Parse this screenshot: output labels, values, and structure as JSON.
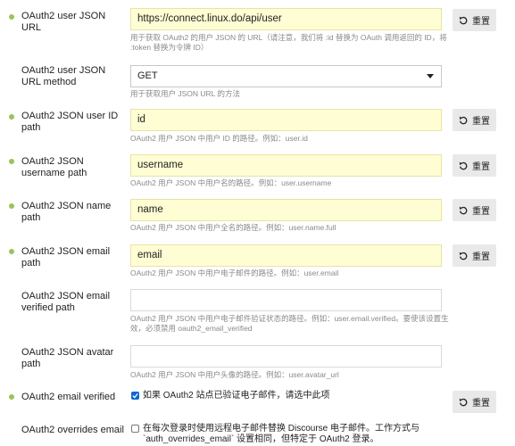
{
  "reset_label": "重置",
  "rows": [
    {
      "label": "OAuth2 user JSON URL",
      "value": "https://connect.linux.do/api/user",
      "desc": "用于获取 OAuth2 的用户 JSON 的 URL（请注意，我们将 :id 替换为 OAuth 调用返回的 ID，将 :token 替换为令牌 ID）"
    },
    {
      "label": "OAuth2 user JSON URL method",
      "value": "GET",
      "desc": "用于获取用户 JSON URL 的方法"
    },
    {
      "label": "OAuth2 JSON user ID path",
      "value": "id",
      "desc": "OAuth2 用户 JSON 中用户 ID 的路径。例如：user.id"
    },
    {
      "label": "OAuth2 JSON username path",
      "value": "username",
      "desc": "OAuth2 用户 JSON 中用户名的路径。例如：user.username"
    },
    {
      "label": "OAuth2 JSON name path",
      "value": "name",
      "desc": "OAuth2 用户 JSON 中用户全名的路径。例如：user.name.full"
    },
    {
      "label": "OAuth2 JSON email path",
      "value": "email",
      "desc": "OAuth2 用户 JSON 中用户电子邮件的路径。例如：user.email"
    },
    {
      "label": "OAuth2 JSON email verified path",
      "value": "",
      "desc": "OAuth2 用户 JSON 中用户电子邮件验证状态的路径。例如：user.email.verified。要使该设置生效，必须禁用 oauth2_email_verified"
    },
    {
      "label": "OAuth2 JSON avatar path",
      "value": "",
      "desc": "OAuth2 用户 JSON 中用户头像的路径。例如：user.avatar_url"
    },
    {
      "label": "OAuth2 email verified",
      "checked": true,
      "desc": "如果 OAuth2 站点已验证电子邮件，请选中此项"
    },
    {
      "label": "OAuth2 overrides email",
      "checked": false,
      "desc": "在每次登录时使用远程电子邮件替换 Discourse 电子邮件。工作方式与 `auth_overrides_email` 设置相同，但特定于 OAuth2 登录。"
    }
  ],
  "colors": {
    "modified_dot": "#9bc35a",
    "dirty_field_bg": "#fffdd3",
    "checkbox_on": "#0a66d3"
  },
  "icons": {
    "reset": "undo-icon",
    "select": "caret-down-icon",
    "check": "check-icon"
  }
}
